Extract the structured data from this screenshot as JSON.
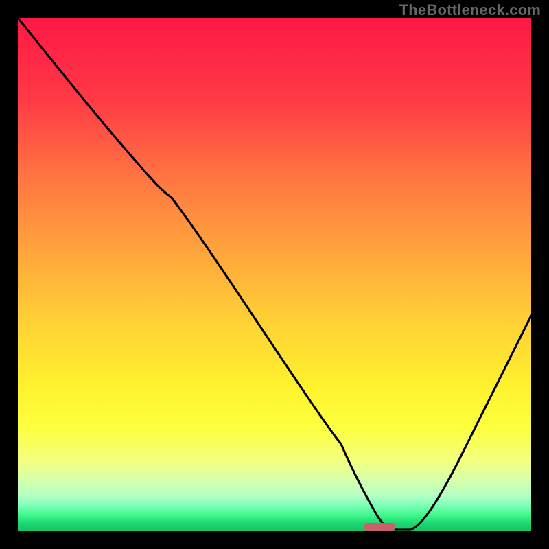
{
  "watermark": "TheBottleneck.com",
  "colors": {
    "background": "#000000",
    "gradient_top": "#ff1846",
    "gradient_mid": "#ffd035",
    "gradient_bottom": "#14c466",
    "curve": "#000000",
    "marker": "#cb6168"
  },
  "chart_data": {
    "type": "line",
    "title": "",
    "xlabel": "",
    "ylabel": "",
    "xlim": [
      0,
      100
    ],
    "ylim": [
      0,
      100
    ],
    "x": [
      0,
      8,
      16,
      24,
      30,
      36,
      42,
      48,
      54,
      60,
      63,
      66,
      70,
      76,
      82,
      88,
      94,
      100
    ],
    "values": [
      100,
      90,
      80,
      71,
      65,
      56,
      47,
      38,
      29,
      17,
      10,
      4,
      1,
      1,
      9,
      20,
      31,
      42
    ],
    "annotations": [
      {
        "kind": "marker",
        "x": 71,
        "y": 0.5,
        "width_pct": 6,
        "color": "#cb6168"
      }
    ]
  }
}
